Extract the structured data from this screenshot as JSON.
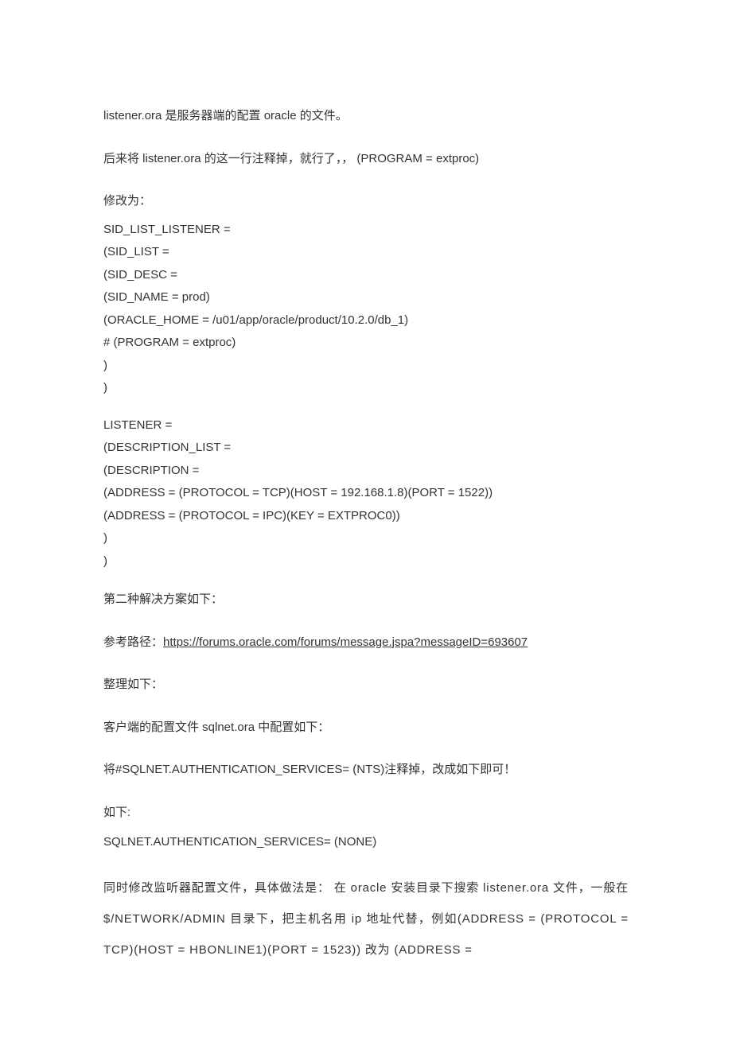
{
  "p1": "listener.ora 是服务器端的配置 oracle 的文件。",
  "p2": "后来将 listener.ora 的这一行注释掉，就行了，，  (PROGRAM = extproc)",
  "p3": "修改为：",
  "code1": {
    "l1": "SID_LIST_LISTENER =",
    "l2": "(SID_LIST =",
    "l3": "(SID_DESC =",
    "l4": "(SID_NAME = prod)",
    "l5": "(ORACLE_HOME = /u01/app/oracle/product/10.2.0/db_1)",
    "l6": "# (PROGRAM = extproc)",
    "l7": ")",
    "l8": ")"
  },
  "code2": {
    "l1": "LISTENER =",
    "l2": "(DESCRIPTION_LIST =",
    "l3": "(DESCRIPTION =",
    "l4": "(ADDRESS = (PROTOCOL = TCP)(HOST = 192.168.1.8)(PORT = 1522))",
    "l5": "(ADDRESS = (PROTOCOL = IPC)(KEY = EXTPROC0))",
    "l6": ")",
    "l7": ")"
  },
  "p4": "第二种解决方案如下：",
  "p5_prefix": "参考路径：",
  "p5_link": "https://forums.oracle.com/forums/message.jspa?messageID=693607",
  "p6": "整理如下：",
  "p7": "客户端的配置文件 sqlnet.ora 中配置如下：",
  "p8": "将#SQLNET.AUTHENTICATION_SERVICES= (NTS)注释掉，改成如下即可！",
  "p9": "如下:",
  "p10": "SQLNET.AUTHENTICATION_SERVICES= (NONE)",
  "p11": "同时修改监听器配置文件，具体做法是：  在 oracle 安装目录下搜索 listener.ora 文件，一般在$/NETWORK/ADMIN 目录下，把主机名用 ip 地址代替，例如(ADDRESS = (PROTOCOL = TCP)(HOST = HBONLINE1)(PORT = 1523)) 改为 (ADDRESS ="
}
